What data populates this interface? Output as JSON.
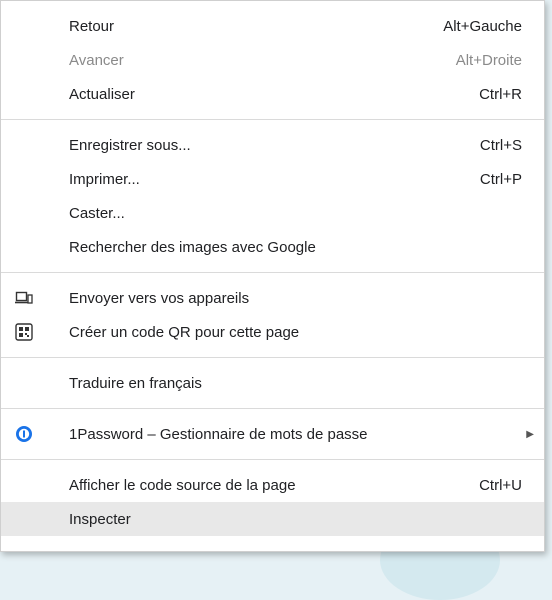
{
  "menu": {
    "groups": [
      [
        {
          "label": "Retour",
          "shortcut": "Alt+Gauche"
        },
        {
          "label": "Avancer",
          "shortcut": "Alt+Droite",
          "disabled": true
        },
        {
          "label": "Actualiser",
          "shortcut": "Ctrl+R"
        }
      ],
      [
        {
          "label": "Enregistrer sous...",
          "shortcut": "Ctrl+S"
        },
        {
          "label": "Imprimer...",
          "shortcut": "Ctrl+P"
        },
        {
          "label": "Caster..."
        },
        {
          "label": "Rechercher des images avec Google"
        }
      ],
      [
        {
          "label": "Envoyer vers vos appareils",
          "icon": "send-to-devices-icon"
        },
        {
          "label": "Créer un code QR pour cette page",
          "icon": "qr-code-icon"
        }
      ],
      [
        {
          "label": "Traduire en français"
        }
      ],
      [
        {
          "label": "1Password – Gestionnaire de mots de passe",
          "icon": "1password-icon",
          "submenu": true
        }
      ],
      [
        {
          "label": "Afficher le code source de la page",
          "shortcut": "Ctrl+U"
        },
        {
          "label": "Inspecter",
          "hovered": true
        }
      ]
    ]
  },
  "colors": {
    "hover_bg": "#e8e8e8",
    "disabled_text": "#8a8a8a",
    "onepassword_blue": "#1a73e8"
  }
}
